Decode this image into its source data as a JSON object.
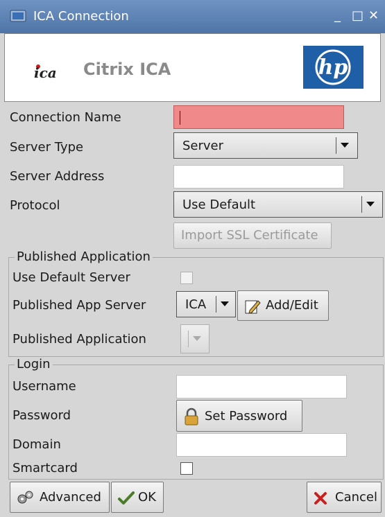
{
  "window": {
    "title": "ICA Connection",
    "minimize": "_",
    "maximize": "□",
    "close": "✕"
  },
  "header": {
    "brand": "Citrix ICA"
  },
  "form": {
    "connection_name_label": "Connection Name",
    "connection_name_value": "",
    "server_type_label": "Server Type",
    "server_type_value": "Server",
    "server_address_label": "Server Address",
    "server_address_value": "",
    "protocol_label": "Protocol",
    "protocol_value": "Use Default",
    "import_ssl_label": "Import SSL Certificate"
  },
  "published": {
    "group_title": "Published Application",
    "use_default_server_label": "Use Default Server",
    "use_default_server_checked": false,
    "app_server_label": "Published App Server",
    "app_server_value": "ICA",
    "add_edit_label": "Add/Edit",
    "application_label": "Published Application",
    "application_value": ""
  },
  "login": {
    "group_title": "Login",
    "username_label": "Username",
    "username_value": "",
    "password_label": "Password",
    "set_password_label": "Set Password",
    "domain_label": "Domain",
    "domain_value": "",
    "smartcard_label": "Smartcard",
    "smartcard_checked": false
  },
  "footer": {
    "advanced_label": "Advanced",
    "ok_label": "OK",
    "cancel_label": "Cancel"
  },
  "icons": [
    "app-icon",
    "ica-logo",
    "hp-logo",
    "edit-icon",
    "lock-icon",
    "advanced-icon",
    "ok-icon",
    "cancel-icon"
  ],
  "colors": {
    "titlebar": "#5b80b2",
    "error_field": "#f08a8a",
    "hp_blue": "#1f5fa8",
    "cancel_x": "#c82020"
  }
}
